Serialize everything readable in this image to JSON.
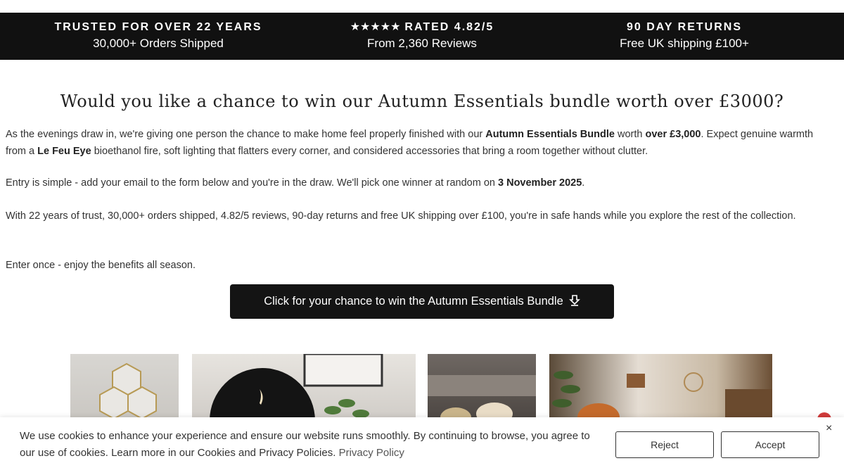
{
  "topbar": [
    {
      "title": "TRUSTED FOR OVER 22 YEARS",
      "subtitle": "30,000+ Orders Shipped"
    },
    {
      "stars": "★★★★★",
      "title": "RATED 4.82/5",
      "subtitle": "From 2,360 Reviews"
    },
    {
      "title": "90 DAY RETURNS",
      "subtitle": "Free UK shipping £100+"
    }
  ],
  "headline": "Would you like a chance to win our Autumn Essentials bundle worth over £3000?",
  "p1": {
    "a": "As the evenings draw in, we're giving one person the chance to make home feel properly finished with our ",
    "b1": "Autumn Essentials Bundle",
    "c": " worth ",
    "b2": "over £3,000",
    "d": ". Expect genuine warmth from a ",
    "b3": "Le Feu Eye",
    "e": " bioethanol fire, soft lighting that flatters every corner, and considered accessories that bring a room together without clutter."
  },
  "p2": {
    "a": "Entry is simple - add your email to the form below and you're in the draw. We'll pick one winner at random on ",
    "b": "3 November 2025",
    "c": "."
  },
  "p3": "With 22 years of trust, 30,000+ orders shipped, 4.82/5 reviews, 90-day returns and free UK shipping over £100, you're in safe hands while you explore the rest of the collection.",
  "p4": "Enter once - enjoy the benefits all season.",
  "cta": {
    "label": "Click for your chance to win the Autumn Essentials Bundle",
    "icon": "download-arrow-icon"
  },
  "cookie": {
    "message": "We use cookies to enhance your experience and ensure our website runs smoothly. By continuing to browse, you agree to our use of cookies. Learn more in our Cookies and Privacy Policies. ",
    "link": "Privacy Policy",
    "reject": "Reject",
    "accept": "Accept",
    "close": "×"
  }
}
